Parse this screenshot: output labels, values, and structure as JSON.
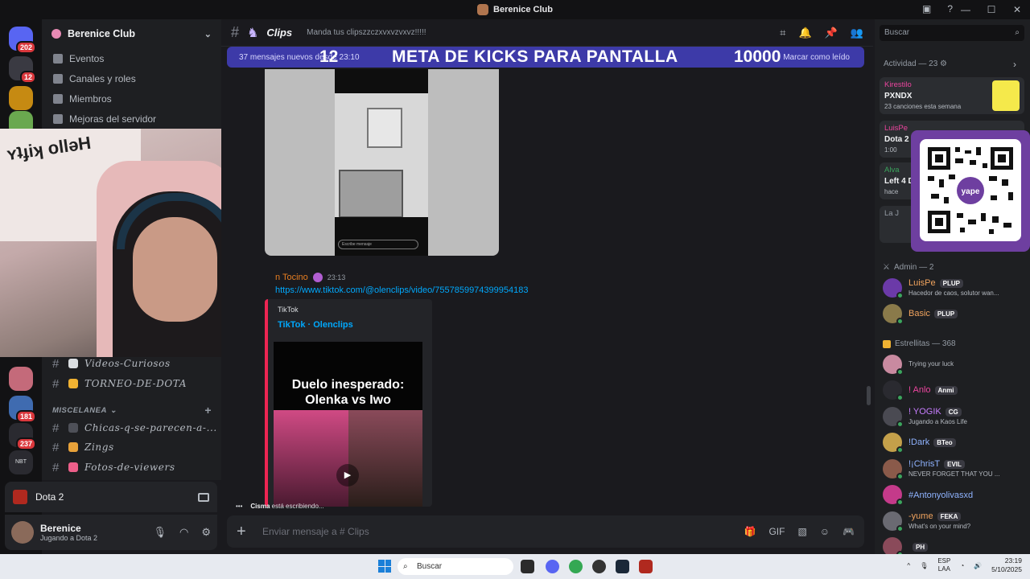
{
  "window": {
    "title": "Berenice Club"
  },
  "server": {
    "name": "Berenice Club",
    "nav": [
      "Eventos",
      "Canales y roles",
      "Miembros",
      "Mejoras del servidor"
    ]
  },
  "guilds": [
    {
      "badge": "202",
      "color": "#5865f2"
    },
    {
      "badge": "12",
      "color": "#3a3a42"
    },
    {
      "badge": "",
      "color": "#c68a12"
    },
    {
      "badge": "",
      "color": "#6aa84f"
    },
    {
      "badge": "",
      "color": "#c46a7a"
    },
    {
      "badge": "181",
      "color": "#3f6bb0"
    },
    {
      "badge": "237",
      "color": "#2a2a30"
    },
    {
      "badge": "",
      "color": "#2a2a30",
      "label": "NBT"
    }
  ],
  "channels_top": [
    {
      "emoji_color": "#dbdee1",
      "name": "Videos-Curiosos"
    },
    {
      "emoji_color": "#f0b232",
      "name": "TORNEO-DE-DOTA"
    }
  ],
  "category": {
    "name": "MISCELANEA"
  },
  "channels_misc": [
    {
      "emoji_color": "#4e5058",
      "name": "Chicas-q-se-parecen-a-..."
    },
    {
      "emoji_color": "#e8a23a",
      "name": "Zings"
    },
    {
      "emoji_color": "#ed5f8a",
      "name": "Fotos-de-viewers"
    }
  ],
  "voice": {
    "game": "Dota 2"
  },
  "user": {
    "name": "Berenice",
    "status": "Jugando a Dota 2"
  },
  "channel": {
    "name": "Clips",
    "topic": "Manda tus clipszzczxvxvzvxvz!!!!!"
  },
  "banner": {
    "new_messages": "37 mensajes nuevos desde 23:10",
    "kicks_left": "12",
    "kicks_title": "META DE KICKS PARA PANTALLA",
    "kicks_goal": "10000",
    "mark_read": "Marcar como leído"
  },
  "video1": {
    "comment_placeholder": "Escribe mensaje"
  },
  "message": {
    "author": "n Tocino",
    "time": "23:13",
    "link": "https://www.tiktok.com/@olenclips/video/7557859974399954183",
    "embed_provider": "TikTok",
    "embed_title": "TikTok · Olenclips",
    "thumb_text": "Duelo inesperado: Olenka vs Iwo"
  },
  "typing": {
    "user": "Cisma",
    "text": "está escribiendo..."
  },
  "composer": {
    "placeholder": "Enviar mensaje a #  Clips"
  },
  "search": {
    "placeholder": "Buscar"
  },
  "activity": {
    "header": "Actividad — 23",
    "cards": [
      {
        "user": "Kirestilo",
        "game": "PXNDX",
        "sub": "23 canciones esta semana"
      },
      {
        "user": "LuisPe",
        "game": "Dota 2",
        "sub": "1:00"
      },
      {
        "user": "Alva",
        "game": "Left 4 D",
        "sub": "hace"
      },
      {
        "user": "La J",
        "game": "",
        "sub": ""
      }
    ]
  },
  "qr": {
    "label": "yape"
  },
  "members": {
    "admin_header": "Admin — 2",
    "admins": [
      {
        "name": "LuisPe",
        "tag": "PLUP",
        "sub": "Hacedor de caos, solutor wan...",
        "color": "#f0a35e",
        "avatar": "#6b3aa8"
      },
      {
        "name": "Basic",
        "tag": "PLUP",
        "sub": "",
        "color": "#f0a35e",
        "avatar": "#8a7a4a"
      }
    ],
    "stars_header": "Estrellitas — 368",
    "stars": [
      {
        "name": "",
        "tag": "",
        "sub": "Trying your luck",
        "color": "#eb459e",
        "avatar": "#c98aa0"
      },
      {
        "name": "! Anlo",
        "tag": "Anmi",
        "sub": "",
        "color": "#eb459e",
        "avatar": "#2a2a30"
      },
      {
        "name": "! YOGIK",
        "tag": "CG",
        "sub": "Jugando a Kaos Life",
        "color": "#c77dff",
        "avatar": "#4a4a52"
      },
      {
        "name": "!Dark",
        "tag": "BTeo",
        "sub": "",
        "color": "#8fb3ff",
        "avatar": "#c4a04a"
      },
      {
        "name": "!¡ChrisT",
        "tag": "EVIL",
        "sub": "NEVER FORGET THAT YOU ...",
        "color": "#8fb3ff",
        "avatar": "#8a5a4a"
      },
      {
        "name": "#Antonyolivasxd",
        "tag": "",
        "sub": "",
        "color": "#8fb3ff",
        "avatar": "#c43a8a"
      },
      {
        "name": "-yume",
        "tag": "FEKA",
        "sub": "What's on your mind?",
        "color": "#f0a35e",
        "avatar": "#6a6a72"
      },
      {
        "name": "",
        "tag": "PH",
        "sub": "",
        "color": "#eb459e",
        "avatar": "#8a4a5a"
      }
    ]
  },
  "taskbar": {
    "search": "Buscar",
    "lang1": "ESP",
    "lang2": "LAA",
    "time": "23:19",
    "date": "5/10/2025"
  }
}
